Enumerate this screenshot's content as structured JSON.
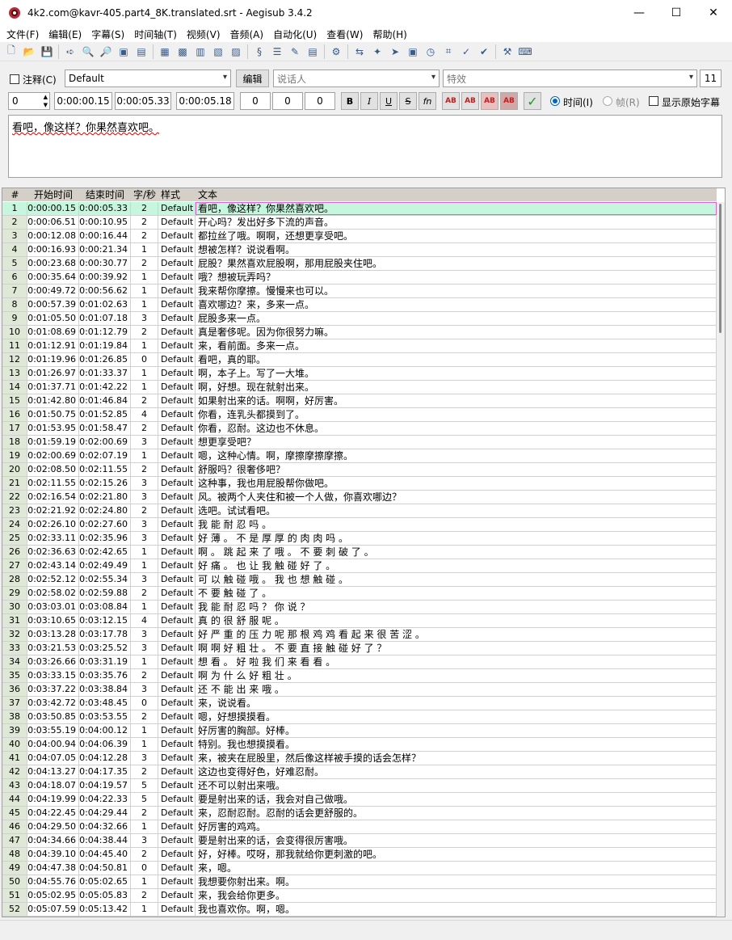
{
  "window": {
    "title": "4k2.com@kavr-405.part4_8K.translated.srt - Aegisub 3.4.2",
    "minimize": "—",
    "maximize": "☐",
    "close": "✕"
  },
  "menu": [
    "文件(F)",
    "编辑(E)",
    "字幕(S)",
    "时间轴(T)",
    "视频(V)",
    "音频(A)",
    "自动化(U)",
    "查看(W)",
    "帮助(H)"
  ],
  "toolbar_icons": [
    "new-file-icon",
    "open-file-icon",
    "save-file-icon",
    "sep",
    "jump-icon",
    "zoom-in-icon",
    "zoom-out-icon",
    "snapshot-icon",
    "snapshot-copy-icon",
    "sep",
    "video-detach-icon",
    "video-zoom-icon",
    "keyframes-icon",
    "video-box-icon",
    "video-details-icon",
    "sep",
    "styles-manager-icon",
    "properties-icon",
    "attachments-icon",
    "fonts-collector-icon",
    "sep",
    "automation-icon",
    "sep",
    "shift-times-icon",
    "timing-postprocessor-icon",
    "kanji-timer-icon",
    "resample-icon",
    "assistant-icon",
    "styling-assistant-icon",
    "translation-assistant-icon",
    "spell-checker-icon",
    "sep",
    "options-icon",
    "hotkeys-icon"
  ],
  "edit": {
    "comment_label": "注释(C)",
    "style_value": "Default",
    "edit_button": "编辑",
    "actor_placeholder": "说话人",
    "effect_placeholder": "特效",
    "char_count": "11",
    "layer": "0",
    "start_time": "0:00:00.15",
    "end_time": "0:00:05.33",
    "duration": "0:00:05.18",
    "margin_l": "0",
    "margin_r": "0",
    "margin_v": "0",
    "fmt_buttons": [
      "B",
      "I",
      "U",
      "S",
      "fn"
    ],
    "color_buttons": [
      "AB",
      "AB",
      "AB",
      "AB"
    ],
    "commit_icon": "✓",
    "time_label": "时间(I)",
    "frame_label": "帧(R)",
    "show_original_label": "显示原始字幕",
    "text": "看吧，像这样？你果然喜欢吧。"
  },
  "grid": {
    "headers": [
      "#",
      "开始时间",
      "结束时间",
      "字/秒",
      "样式",
      "文本"
    ],
    "rows": [
      [
        "1",
        "0:00:00.15",
        "0:00:05.33",
        "2",
        "Default",
        "看吧，像这样？你果然喜欢吧。"
      ],
      [
        "2",
        "0:00:06.51",
        "0:00:10.95",
        "2",
        "Default",
        "开心吗？发出好多下流的声音。"
      ],
      [
        "3",
        "0:00:12.08",
        "0:00:16.44",
        "2",
        "Default",
        "都拉丝了哦。啊啊，还想更享受吧。"
      ],
      [
        "4",
        "0:00:16.93",
        "0:00:21.34",
        "1",
        "Default",
        "想被怎样？说说看啊。"
      ],
      [
        "5",
        "0:00:23.68",
        "0:00:30.77",
        "2",
        "Default",
        "屁股？果然喜欢屁股啊，那用屁股夹住吧。"
      ],
      [
        "6",
        "0:00:35.64",
        "0:00:39.92",
        "1",
        "Default",
        "哦？想被玩弄吗？"
      ],
      [
        "7",
        "0:00:49.72",
        "0:00:56.62",
        "1",
        "Default",
        "我来帮你摩擦。慢慢来也可以。"
      ],
      [
        "8",
        "0:00:57.39",
        "0:01:02.63",
        "1",
        "Default",
        "喜欢哪边？来，多来一点。"
      ],
      [
        "9",
        "0:01:05.50",
        "0:01:07.18",
        "3",
        "Default",
        "屁股多来一点。"
      ],
      [
        "10",
        "0:01:08.69",
        "0:01:12.79",
        "2",
        "Default",
        "真是奢侈呢。因为你很努力嘛。"
      ],
      [
        "11",
        "0:01:12.91",
        "0:01:19.84",
        "1",
        "Default",
        "来，看前面。多来一点。"
      ],
      [
        "12",
        "0:01:19.96",
        "0:01:26.85",
        "0",
        "Default",
        "看吧，真的耶。"
      ],
      [
        "13",
        "0:01:26.97",
        "0:01:33.37",
        "1",
        "Default",
        "啊，本子上。写了一大堆。"
      ],
      [
        "14",
        "0:01:37.71",
        "0:01:42.22",
        "1",
        "Default",
        "啊，好想。现在就射出来。"
      ],
      [
        "15",
        "0:01:42.80",
        "0:01:46.84",
        "2",
        "Default",
        "如果射出来的话。啊啊，好厉害。"
      ],
      [
        "16",
        "0:01:50.75",
        "0:01:52.85",
        "4",
        "Default",
        "你看，连乳头都摸到了。"
      ],
      [
        "17",
        "0:01:53.95",
        "0:01:58.47",
        "2",
        "Default",
        "你看，忍耐。这边也不休息。"
      ],
      [
        "18",
        "0:01:59.19",
        "0:02:00.69",
        "3",
        "Default",
        "想更享受吧？"
      ],
      [
        "19",
        "0:02:00.69",
        "0:02:07.19",
        "1",
        "Default",
        "嗯，这种心情。啊，摩擦摩擦摩擦。"
      ],
      [
        "20",
        "0:02:08.50",
        "0:02:11.55",
        "2",
        "Default",
        "舒服吗？很奢侈吧？"
      ],
      [
        "21",
        "0:02:11.55",
        "0:02:15.26",
        "3",
        "Default",
        "这种事，我也用屁股帮你做吧。"
      ],
      [
        "22",
        "0:02:16.54",
        "0:02:21.80",
        "3",
        "Default",
        "风。被两个人夹住和被一个人做，你喜欢哪边？"
      ],
      [
        "23",
        "0:02:21.92",
        "0:02:24.80",
        "2",
        "Default",
        "选吧。试试看吧。"
      ],
      [
        "24",
        "0:02:26.10",
        "0:02:27.60",
        "3",
        "Default",
        "我 能 耐 忍 吗 。"
      ],
      [
        "25",
        "0:02:33.11",
        "0:02:35.96",
        "3",
        "Default",
        "好 薄 。 不 是 厚 厚 的 肉 肉 吗 。"
      ],
      [
        "26",
        "0:02:36.63",
        "0:02:42.65",
        "1",
        "Default",
        "啊 。 跳 起 来 了 哦 。 不 要 刺 破 了 。"
      ],
      [
        "27",
        "0:02:43.14",
        "0:02:49.49",
        "1",
        "Default",
        "好 痛 。 也 让 我 触 碰 好 了 。"
      ],
      [
        "28",
        "0:02:52.12",
        "0:02:55.34",
        "3",
        "Default",
        "可 以 触 碰 哦 。 我 也 想 触 碰 。"
      ],
      [
        "29",
        "0:02:58.02",
        "0:02:59.88",
        "2",
        "Default",
        "不 要 触 碰 了 。"
      ],
      [
        "30",
        "0:03:03.01",
        "0:03:08.84",
        "1",
        "Default",
        "我 能 耐 忍 吗 ？ 你 说 ？"
      ],
      [
        "31",
        "0:03:10.65",
        "0:03:12.15",
        "4",
        "Default",
        "真 的 很 舒 服 呢 。"
      ],
      [
        "32",
        "0:03:13.28",
        "0:03:17.78",
        "3",
        "Default",
        "好 严 重 的 压 力 呢 那 根 鸡 鸡 看 起 来 很 苦 涩 。"
      ],
      [
        "33",
        "0:03:21.53",
        "0:03:25.52",
        "3",
        "Default",
        "啊 啊 好 粗 壮 。 不 要 直 接 触 碰 好 了 ？"
      ],
      [
        "34",
        "0:03:26.66",
        "0:03:31.19",
        "1",
        "Default",
        "想 看 。 好 啦 我 们 来 看 看 。"
      ],
      [
        "35",
        "0:03:33.15",
        "0:03:35.76",
        "2",
        "Default",
        "啊 为 什 么 好 粗 壮 。"
      ],
      [
        "36",
        "0:03:37.22",
        "0:03:38.84",
        "3",
        "Default",
        "还 不 能 出 来 哦 。"
      ],
      [
        "37",
        "0:03:42.72",
        "0:03:48.45",
        "0",
        "Default",
        "来，说说看。"
      ],
      [
        "38",
        "0:03:50.85",
        "0:03:53.55",
        "2",
        "Default",
        "嗯，好想摸摸看。"
      ],
      [
        "39",
        "0:03:55.19",
        "0:04:00.12",
        "1",
        "Default",
        "好厉害的胸部。好棒。"
      ],
      [
        "40",
        "0:04:00.94",
        "0:04:06.39",
        "1",
        "Default",
        "特别。我也想摸摸看。"
      ],
      [
        "41",
        "0:04:07.05",
        "0:04:12.28",
        "3",
        "Default",
        "来，被夹在屁股里，然后像这样被手摸的话会怎样？"
      ],
      [
        "42",
        "0:04:13.27",
        "0:04:17.35",
        "2",
        "Default",
        "这边也变得好色，好难忍耐。"
      ],
      [
        "43",
        "0:04:18.07",
        "0:04:19.57",
        "5",
        "Default",
        "还不可以射出来哦。"
      ],
      [
        "44",
        "0:04:19.99",
        "0:04:22.33",
        "5",
        "Default",
        "要是射出来的话，我会对自己做哦。"
      ],
      [
        "45",
        "0:04:22.45",
        "0:04:29.44",
        "2",
        "Default",
        "来，忍耐忍耐。忍耐的话会更舒服的。"
      ],
      [
        "46",
        "0:04:29.50",
        "0:04:32.66",
        "1",
        "Default",
        "好厉害的鸡鸡。"
      ],
      [
        "47",
        "0:04:34.66",
        "0:04:38.44",
        "3",
        "Default",
        "要是射出来的话，会变得很厉害哦。"
      ],
      [
        "48",
        "0:04:39.10",
        "0:04:45.40",
        "2",
        "Default",
        "好，好棒。哎呀，那我就给你更刺激的吧。"
      ],
      [
        "49",
        "0:04:47.38",
        "0:04:50.81",
        "0",
        "Default",
        "来，嗯。"
      ],
      [
        "50",
        "0:04:55.76",
        "0:05:02.65",
        "1",
        "Default",
        "我想要你射出来。啊。"
      ],
      [
        "51",
        "0:05:02.95",
        "0:05:05.83",
        "2",
        "Default",
        "来，我会给你更多。"
      ],
      [
        "52",
        "0:05:07.59",
        "0:05:13.42",
        "1",
        "Default",
        "我也喜欢你。啊，嗯。"
      ]
    ]
  },
  "colors": {
    "selected_row": "#c6f6dd",
    "number_column": "#dfe8d6",
    "header": "#d4d0c8",
    "accent": "#0067c0"
  }
}
